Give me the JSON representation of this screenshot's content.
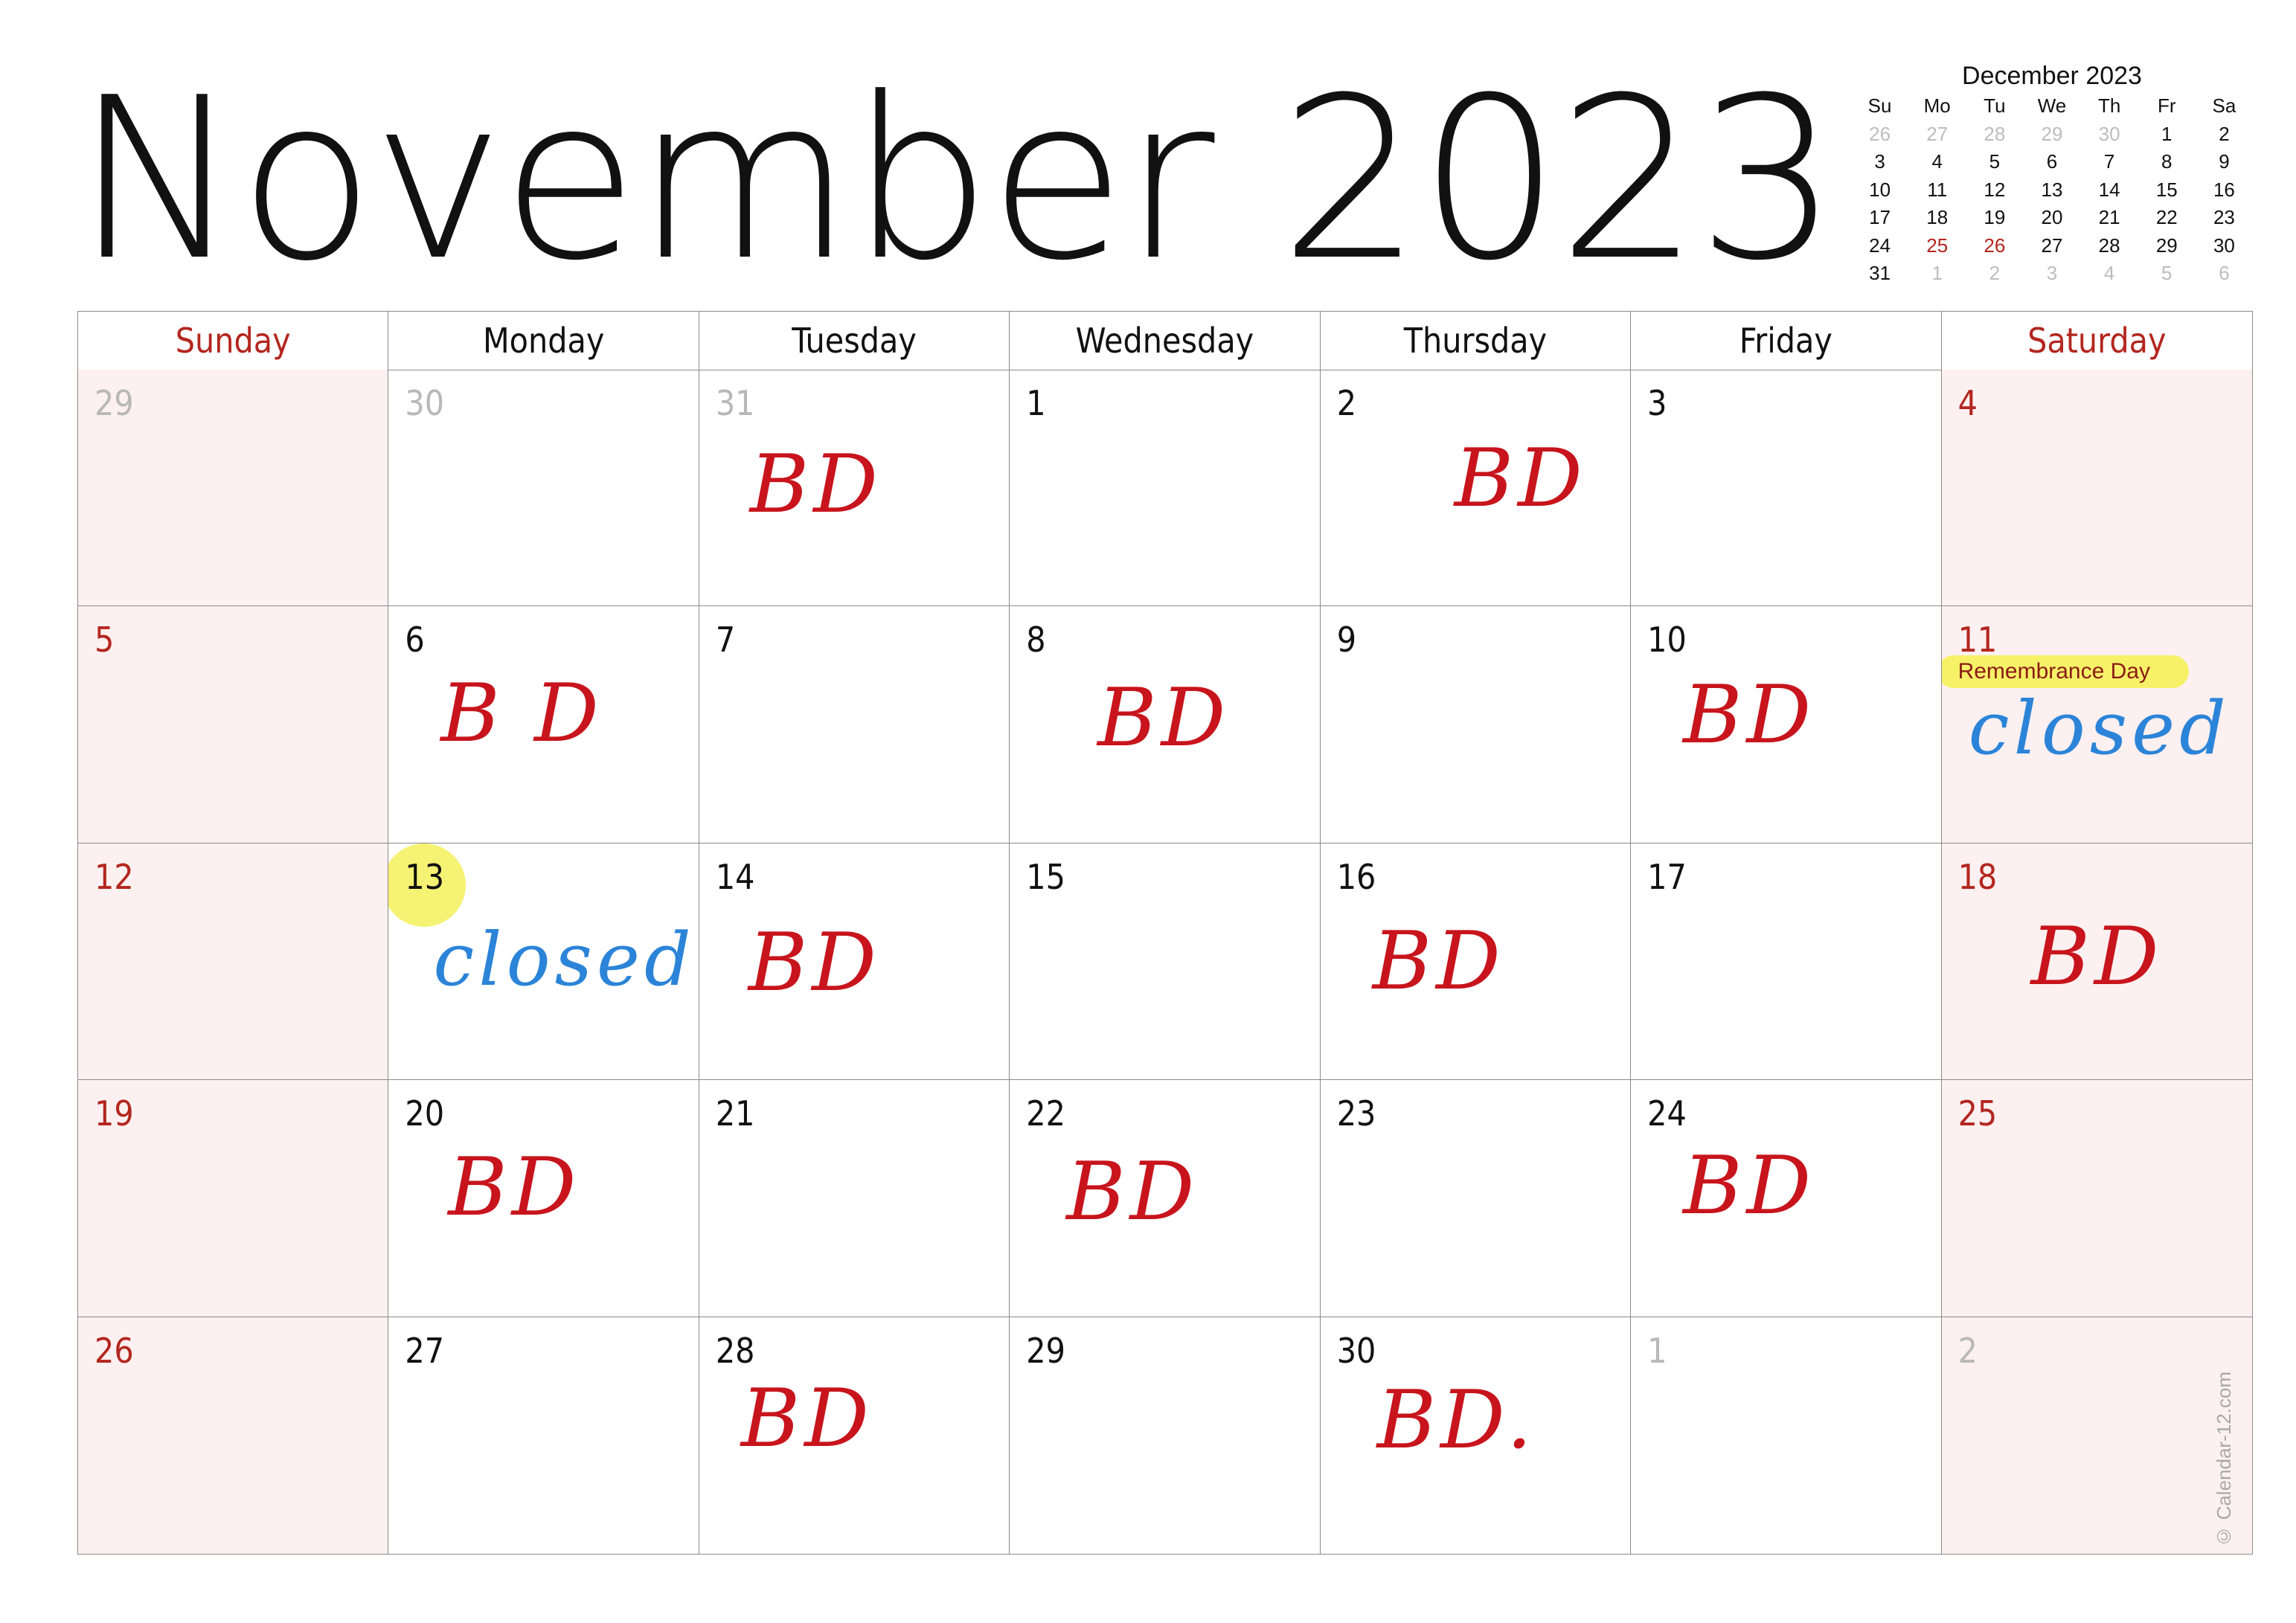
{
  "title": "November 2023",
  "mini_calendar": {
    "title": "December 2023",
    "weekdays": [
      "Su",
      "Mo",
      "Tu",
      "We",
      "Th",
      "Fr",
      "Sa"
    ],
    "days": [
      {
        "d": "26",
        "s": "dim"
      },
      {
        "d": "27",
        "s": "dim"
      },
      {
        "d": "28",
        "s": "dim"
      },
      {
        "d": "29",
        "s": "dim"
      },
      {
        "d": "30",
        "s": "dim"
      },
      {
        "d": "1",
        "s": ""
      },
      {
        "d": "2",
        "s": ""
      },
      {
        "d": "3",
        "s": ""
      },
      {
        "d": "4",
        "s": ""
      },
      {
        "d": "5",
        "s": ""
      },
      {
        "d": "6",
        "s": ""
      },
      {
        "d": "7",
        "s": ""
      },
      {
        "d": "8",
        "s": ""
      },
      {
        "d": "9",
        "s": ""
      },
      {
        "d": "10",
        "s": ""
      },
      {
        "d": "11",
        "s": ""
      },
      {
        "d": "12",
        "s": ""
      },
      {
        "d": "13",
        "s": ""
      },
      {
        "d": "14",
        "s": ""
      },
      {
        "d": "15",
        "s": ""
      },
      {
        "d": "16",
        "s": ""
      },
      {
        "d": "17",
        "s": ""
      },
      {
        "d": "18",
        "s": ""
      },
      {
        "d": "19",
        "s": ""
      },
      {
        "d": "20",
        "s": ""
      },
      {
        "d": "21",
        "s": ""
      },
      {
        "d": "22",
        "s": ""
      },
      {
        "d": "23",
        "s": ""
      },
      {
        "d": "24",
        "s": ""
      },
      {
        "d": "25",
        "s": "red"
      },
      {
        "d": "26",
        "s": "red"
      },
      {
        "d": "27",
        "s": ""
      },
      {
        "d": "28",
        "s": ""
      },
      {
        "d": "29",
        "s": ""
      },
      {
        "d": "30",
        "s": ""
      },
      {
        "d": "31",
        "s": ""
      },
      {
        "d": "1",
        "s": "dim"
      },
      {
        "d": "2",
        "s": "dim"
      },
      {
        "d": "3",
        "s": "dim"
      },
      {
        "d": "4",
        "s": "dim"
      },
      {
        "d": "5",
        "s": "dim"
      },
      {
        "d": "6",
        "s": "dim"
      }
    ]
  },
  "weekday_headers": [
    "Sunday",
    "Monday",
    "Tuesday",
    "Wednesday",
    "Thursday",
    "Friday",
    "Saturday"
  ],
  "colors": {
    "weekend_text": "#b3261e",
    "weekend_fill": "#fdf0f0",
    "bd_ink": "#c8141c",
    "closed_ink": "#2b84d8",
    "highlight": "#f5f05a"
  },
  "cells": [
    {
      "day": "29",
      "out": true,
      "note": "",
      "kind": ""
    },
    {
      "day": "30",
      "out": true,
      "note": "",
      "kind": ""
    },
    {
      "day": "31",
      "out": true,
      "note": "BD",
      "kind": "bd"
    },
    {
      "day": "1",
      "note": "",
      "kind": ""
    },
    {
      "day": "2",
      "note": "BD",
      "kind": "bd"
    },
    {
      "day": "3",
      "note": "",
      "kind": ""
    },
    {
      "day": "4",
      "note": "",
      "kind": ""
    },
    {
      "day": "5",
      "note": "",
      "kind": ""
    },
    {
      "day": "6",
      "note": "B D",
      "kind": "bd"
    },
    {
      "day": "7",
      "note": "",
      "kind": ""
    },
    {
      "day": "8",
      "note": "BD",
      "kind": "bd"
    },
    {
      "day": "9",
      "note": "",
      "kind": ""
    },
    {
      "day": "10",
      "note": "BD",
      "kind": "bd"
    },
    {
      "day": "11",
      "note": "closed",
      "kind": "closed",
      "holiday": "Remembrance Day"
    },
    {
      "day": "12",
      "note": "",
      "kind": ""
    },
    {
      "day": "13",
      "note": "closed",
      "kind": "closed",
      "highlight": true
    },
    {
      "day": "14",
      "note": "BD",
      "kind": "bd"
    },
    {
      "day": "15",
      "note": "",
      "kind": ""
    },
    {
      "day": "16",
      "note": "BD",
      "kind": "bd"
    },
    {
      "day": "17",
      "note": "",
      "kind": ""
    },
    {
      "day": "18",
      "note": "BD",
      "kind": "bd"
    },
    {
      "day": "19",
      "note": "",
      "kind": ""
    },
    {
      "day": "20",
      "note": "BD",
      "kind": "bd"
    },
    {
      "day": "21",
      "note": "",
      "kind": ""
    },
    {
      "day": "22",
      "note": "BD",
      "kind": "bd"
    },
    {
      "day": "23",
      "note": "",
      "kind": ""
    },
    {
      "day": "24",
      "note": "BD",
      "kind": "bd"
    },
    {
      "day": "25",
      "note": "",
      "kind": ""
    },
    {
      "day": "26",
      "note": "",
      "kind": ""
    },
    {
      "day": "27",
      "note": "",
      "kind": ""
    },
    {
      "day": "28",
      "note": "BD",
      "kind": "bd"
    },
    {
      "day": "29",
      "note": "",
      "kind": ""
    },
    {
      "day": "30",
      "note": "BD.",
      "kind": "bd"
    },
    {
      "day": "1",
      "out": true,
      "note": "",
      "kind": ""
    },
    {
      "day": "2",
      "out": true,
      "note": "",
      "kind": ""
    }
  ],
  "credit": "© Calendar-12.com"
}
